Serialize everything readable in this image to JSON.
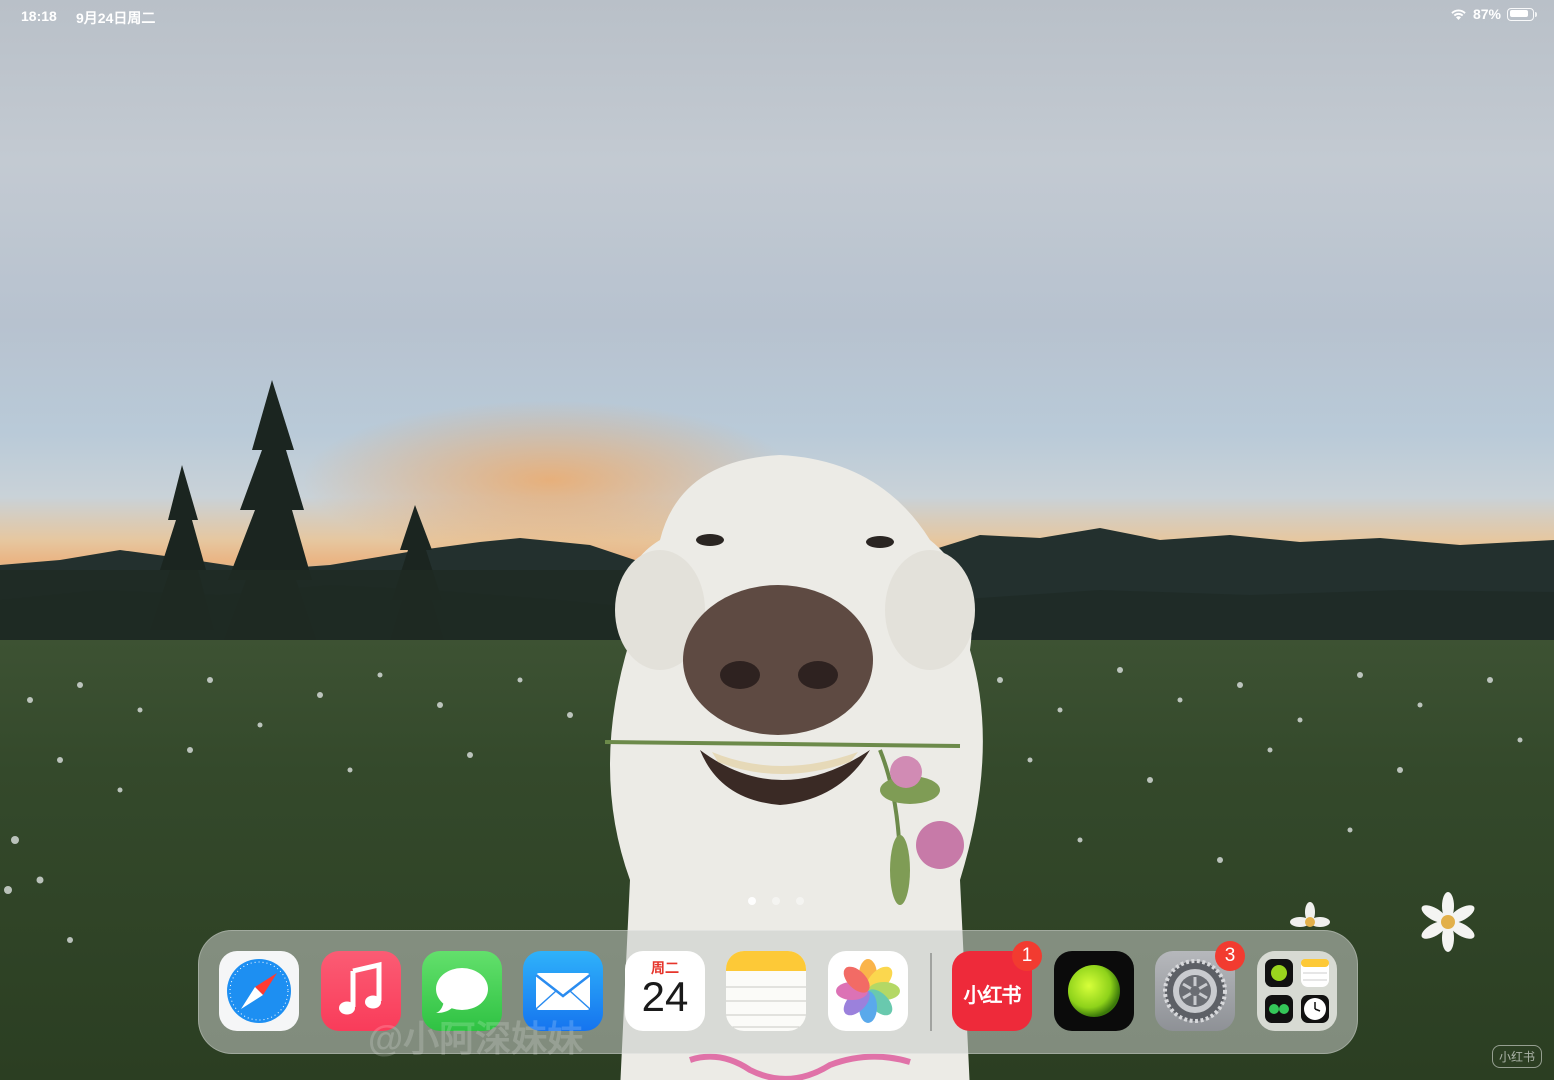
{
  "status_bar": {
    "time": "18:18",
    "date": "9月24日周二",
    "battery_percent_text": "87%",
    "battery_level": 0.87,
    "wifi_icon": "wifi-icon"
  },
  "home_screen": {
    "page_count": 3,
    "current_page": 1
  },
  "dock": {
    "apps": [
      {
        "name": "Safari",
        "icon": "safari-icon"
      },
      {
        "name": "Music",
        "icon": "music-icon"
      },
      {
        "name": "Messages",
        "icon": "messages-icon"
      },
      {
        "name": "Mail",
        "icon": "mail-icon"
      },
      {
        "name": "Calendar",
        "icon": "calendar-icon",
        "weekday": "周二",
        "day": "24"
      },
      {
        "name": "Notes",
        "icon": "notes-icon"
      },
      {
        "name": "Photos",
        "icon": "photos-icon"
      }
    ],
    "recent_apps": [
      {
        "name": "小红书",
        "icon": "xiaohongshu-icon",
        "label": "小红书",
        "badge": "1"
      },
      {
        "name": "Ball",
        "icon": "green-ball-icon"
      },
      {
        "name": "Settings",
        "icon": "settings-icon",
        "badge": "3"
      },
      {
        "name": "App Library",
        "icon": "app-library-icon"
      }
    ]
  },
  "overlay": {
    "watermark": "@小阿深妹妹",
    "corner_mark": "小红书"
  },
  "colors": {
    "badge": "#f23b30",
    "xiaohongshu": "#ee2a3a",
    "messages": "#34c759",
    "mail": "#1e8af5",
    "music": "#f94257"
  }
}
